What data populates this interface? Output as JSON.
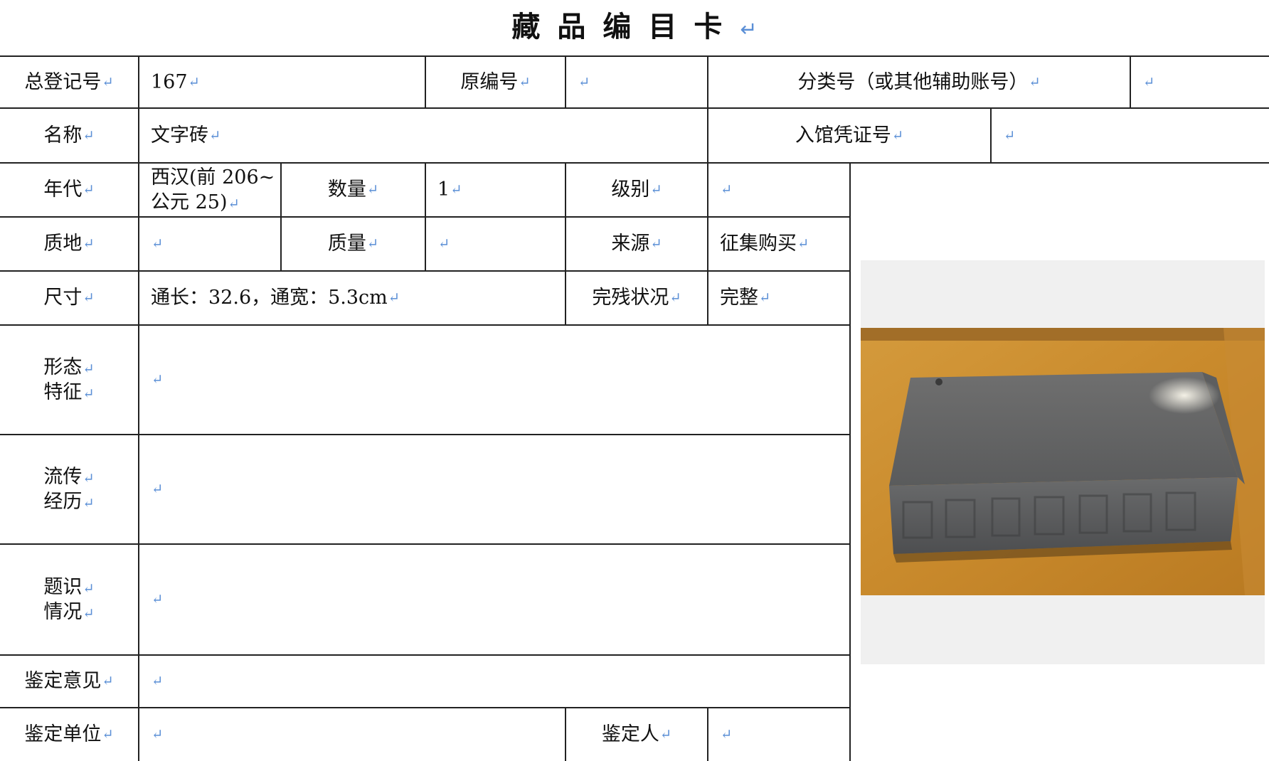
{
  "title": "藏品编目卡",
  "mark": "↵",
  "rows": {
    "r1": {
      "label_regno": "总登记号",
      "regno": "167",
      "label_origno": "原编号",
      "origno": "",
      "label_classno": "分类号（或其他辅助账号）",
      "classno": ""
    },
    "r2": {
      "label_name": "名称",
      "name": "文字砖",
      "label_voucher": "入馆凭证号",
      "voucher": ""
    },
    "r3": {
      "label_era": "年代",
      "era_line1": "西汉(前 206~",
      "era_line2": "公元 25)",
      "label_qty": "数量",
      "qty": "1",
      "label_grade": "级别",
      "grade": ""
    },
    "r4": {
      "label_material": "质地",
      "material": "",
      "label_weight": "质量",
      "weight": "",
      "label_source": "来源",
      "source": "征集购买"
    },
    "r5": {
      "label_size": "尺寸",
      "size": "通长：32.6，通宽：5.3cm",
      "label_condition": "完残状况",
      "condition": "完整"
    },
    "r6": {
      "label_l1": "形态",
      "label_l2": "特征",
      "value": ""
    },
    "r7": {
      "label_l1": "流传",
      "label_l2": "经历",
      "value": ""
    },
    "r8": {
      "label_l1": "题识",
      "label_l2": "情况",
      "value": ""
    },
    "r9": {
      "label": "鉴定意见",
      "value": ""
    },
    "r10": {
      "label_unit": "鉴定单位",
      "unit": "",
      "label_person": "鉴定人",
      "person": ""
    }
  },
  "photo": {
    "subject": "brick-photo"
  }
}
